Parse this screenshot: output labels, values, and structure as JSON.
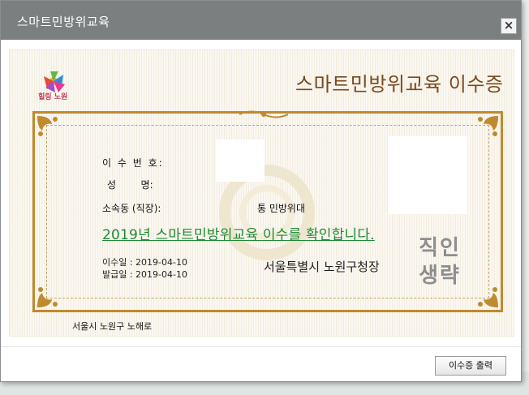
{
  "dialog": {
    "title": "스마트민방위교육",
    "close_label": "×",
    "print_button": "이수증 출력"
  },
  "certificate": {
    "logo_text": "힐링 노원",
    "title": "스마트민방위교육 이수증",
    "fields": [
      {
        "label": "이 수 번 호:",
        "value": ""
      },
      {
        "label": "성        명:",
        "value": ""
      },
      {
        "label": "소속동 (직장):",
        "value": "통 민방위대"
      }
    ],
    "confirmation": "2019년 스마트민방위교육 이수를 확인합니다.",
    "completed_label": "이수일 : 2019-04-10",
    "issued_label": "발급일 : 2019-04-10",
    "issuer": "서울특별시 노원구청장",
    "seal_text": "직인생략",
    "address": "서울시 노원구 노해로"
  },
  "colors": {
    "title_bar": "#7c7f80",
    "cert_title": "#7a4a1e",
    "frame": "#c08a2e",
    "confirm_text": "#1f8a34"
  }
}
